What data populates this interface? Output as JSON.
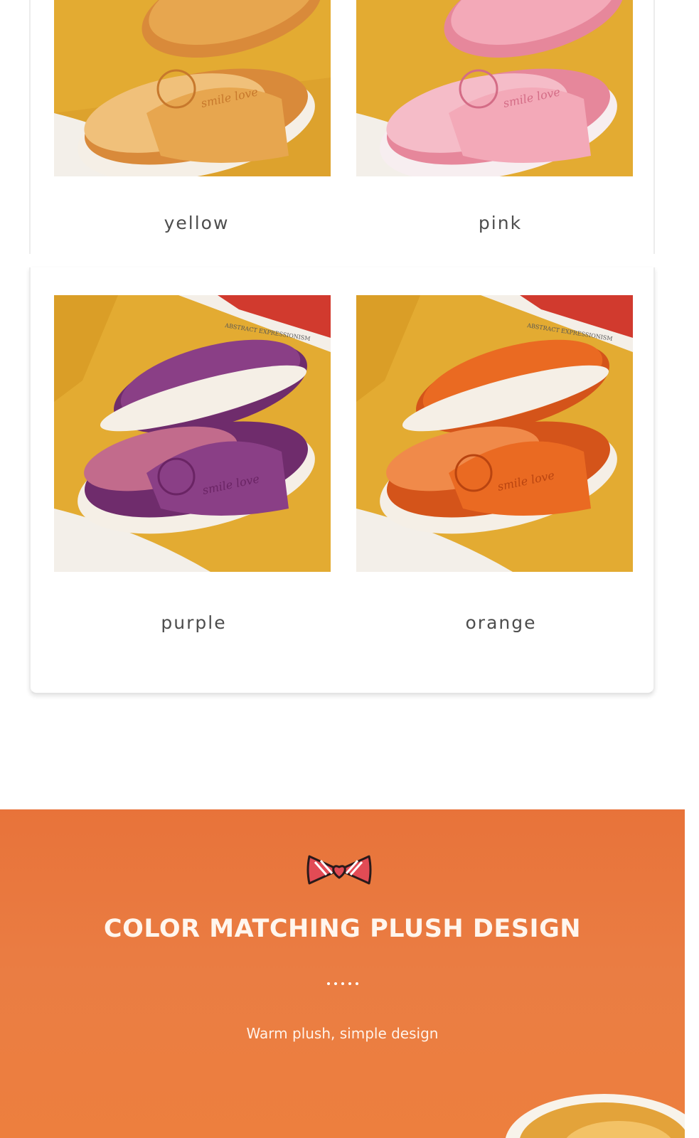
{
  "products": {
    "yellow": {
      "label": "yellow",
      "body_color": "#e7a64f",
      "sole_color": "#d98a3a",
      "lining_color": "#f0c07a",
      "bg_color": "#e3ab32"
    },
    "pink": {
      "label": "pink",
      "body_color": "#f3a9b8",
      "sole_color": "#e6879b",
      "lining_color": "#f5bcc8",
      "bg_color": "#e3ab32"
    },
    "purple": {
      "label": "purple",
      "body_color": "#8a3f86",
      "sole_color": "#6f2c6c",
      "lining_color": "#c26b8c",
      "bg_color": "#e3ab32"
    },
    "orange": {
      "label": "orange",
      "body_color": "#ea6a22",
      "sole_color": "#d4541a",
      "lining_color": "#f08a4a",
      "bg_color": "#e3ab32"
    }
  },
  "embroidery": "smile love",
  "book_caption": "ABSTRACT EXPRESSIONISM",
  "promo": {
    "title": "COLOR MATCHING PLUSH DESIGN",
    "subtitle": "Warm plush, simple design",
    "bow_icon": "bow-icon",
    "bg_color": "#ea7a3f"
  }
}
